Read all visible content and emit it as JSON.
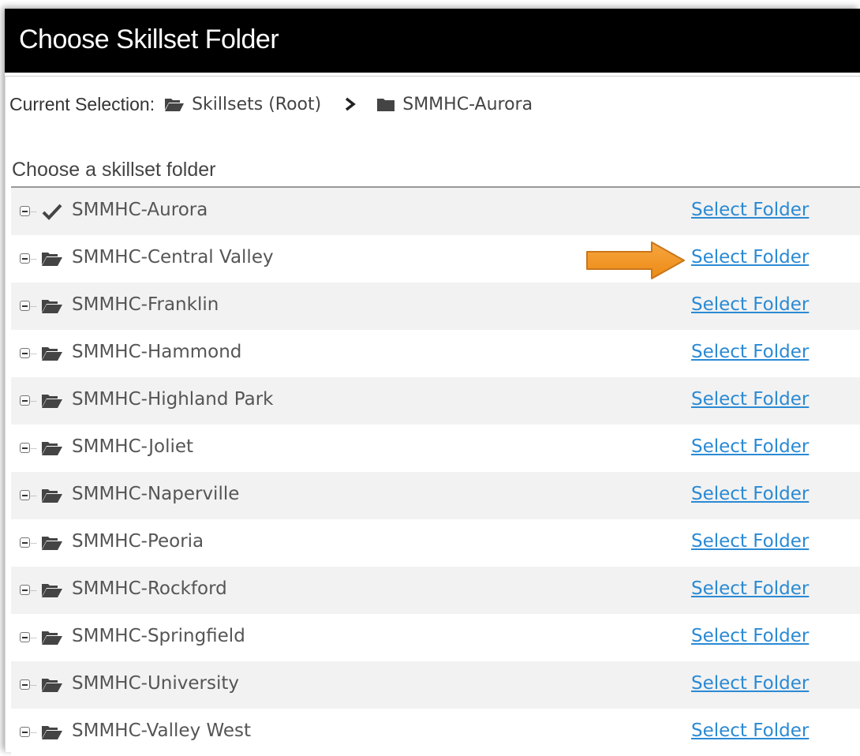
{
  "dialog": {
    "title": "Choose Skillset Folder"
  },
  "current_selection": {
    "label": "Current Selection:",
    "crumbs": [
      {
        "label": "Skillsets (Root)",
        "icon": "folder-open-icon"
      },
      {
        "label": "SMMHC-Aurora",
        "icon": "folder-icon"
      }
    ],
    "separator_icon": "chevron-right-icon"
  },
  "section": {
    "heading": "Choose a skillset folder"
  },
  "folders": [
    {
      "name": "SMMHC-Aurora",
      "icon": "checkmark-icon",
      "selected": true,
      "action": "Select Folder"
    },
    {
      "name": "SMMHC-Central Valley",
      "icon": "folder-open-icon",
      "selected": false,
      "action": "Select Folder"
    },
    {
      "name": "SMMHC-Franklin",
      "icon": "folder-open-icon",
      "selected": false,
      "action": "Select Folder"
    },
    {
      "name": "SMMHC-Hammond",
      "icon": "folder-open-icon",
      "selected": false,
      "action": "Select Folder"
    },
    {
      "name": "SMMHC-Highland Park",
      "icon": "folder-open-icon",
      "selected": false,
      "action": "Select Folder"
    },
    {
      "name": "SMMHC-Joliet",
      "icon": "folder-open-icon",
      "selected": false,
      "action": "Select Folder"
    },
    {
      "name": "SMMHC-Naperville",
      "icon": "folder-open-icon",
      "selected": false,
      "action": "Select Folder"
    },
    {
      "name": "SMMHC-Peoria",
      "icon": "folder-open-icon",
      "selected": false,
      "action": "Select Folder"
    },
    {
      "name": "SMMHC-Rockford",
      "icon": "folder-open-icon",
      "selected": false,
      "action": "Select Folder"
    },
    {
      "name": "SMMHC-Springfield",
      "icon": "folder-open-icon",
      "selected": false,
      "action": "Select Folder"
    },
    {
      "name": "SMMHC-University",
      "icon": "folder-open-icon",
      "selected": false,
      "action": "Select Folder"
    },
    {
      "name": "SMMHC-Valley West",
      "icon": "folder-open-icon",
      "selected": false,
      "action": "Select Folder"
    }
  ],
  "annotation": {
    "icon": "arrow-right-icon",
    "color": "#f29423"
  },
  "colors": {
    "titlebar": "#000000",
    "link": "#2a8ad4",
    "row_alt": "#f2f2f2"
  }
}
